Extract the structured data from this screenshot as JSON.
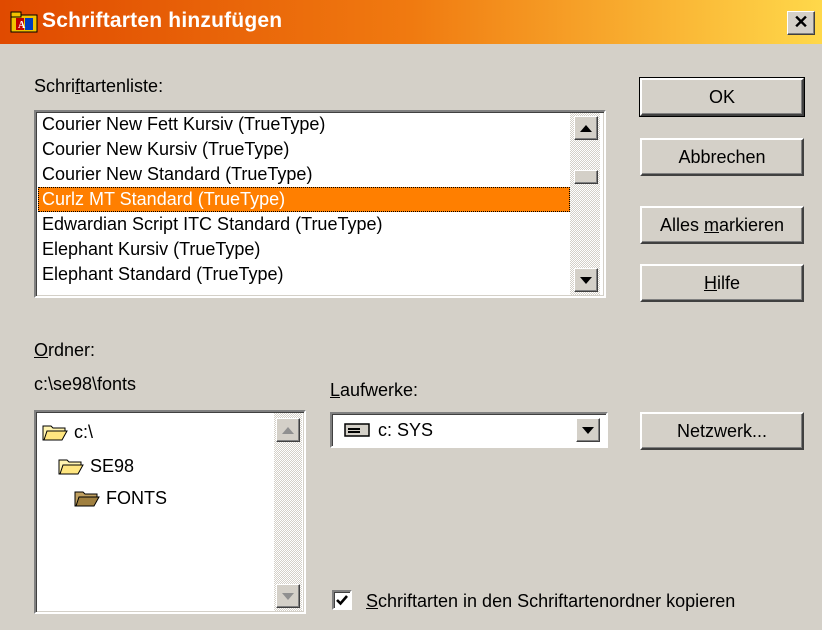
{
  "window": {
    "title": "Schriftarten hinzufügen",
    "close_glyph": "✕"
  },
  "font_list": {
    "label_pre": "Schri",
    "label_accel": "f",
    "label_post": "tartenliste:",
    "items": [
      "Courier New Fett Kursiv (TrueType)",
      "Courier New Kursiv (TrueType)",
      "Courier New Standard (TrueType)",
      "Curlz MT Standard (TrueType)",
      "Edwardian Script ITC Standard (TrueType)",
      "Elephant Kursiv (TrueType)",
      "Elephant Standard (TrueType)"
    ],
    "selected_index": 3,
    "selection_color": "#ff7f00"
  },
  "folder": {
    "label_accel": "O",
    "label_post": "rdner:",
    "path": "c:\\se98\\fonts",
    "tree": [
      "c:\\",
      "SE98",
      "FONTS"
    ]
  },
  "drives": {
    "label_accel": "L",
    "label_post": "aufwerke:",
    "value": "c: SYS"
  },
  "buttons": {
    "ok": "OK",
    "cancel": "Abbrechen",
    "select_all_pre": "Alles ",
    "select_all_accel": "m",
    "select_all_post": "arkieren",
    "help_accel": "H",
    "help_post": "ilfe",
    "network": "Netzwerk..."
  },
  "copy_checkbox": {
    "checked": true,
    "label_accel": "S",
    "label_post": "chriftarten in den Schriftartenordner kopieren"
  }
}
